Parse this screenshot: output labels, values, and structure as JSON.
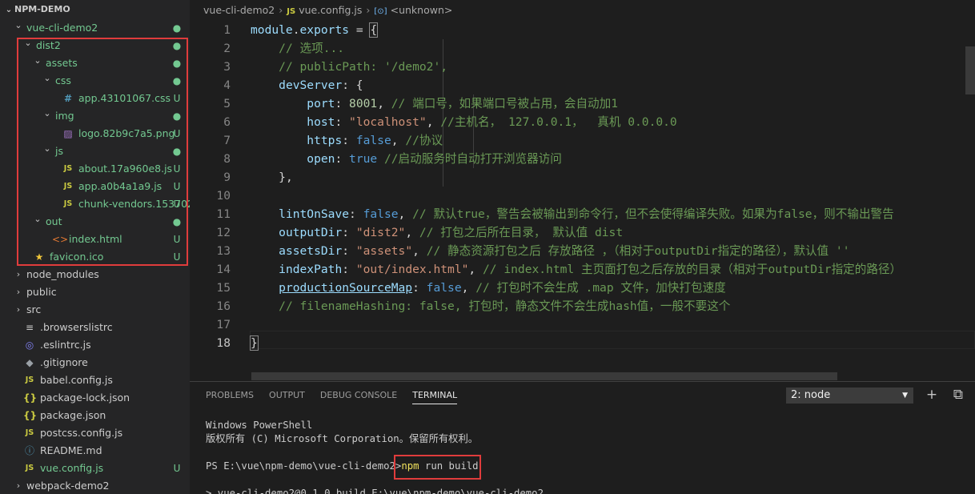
{
  "sidebar": {
    "section_title": "NPM-DEMO",
    "items": [
      {
        "label": "vue-cli-demo2",
        "kind": "folder",
        "open": true,
        "status": "dot"
      },
      {
        "label": "dist2",
        "kind": "folder",
        "open": true,
        "status": "dot"
      },
      {
        "label": "assets",
        "kind": "folder",
        "open": true,
        "status": "dot"
      },
      {
        "label": "css",
        "kind": "folder",
        "open": true,
        "status": "dot"
      },
      {
        "label": "app.43101067.css",
        "kind": "css",
        "status": "U"
      },
      {
        "label": "img",
        "kind": "folder",
        "open": true,
        "status": "dot"
      },
      {
        "label": "logo.82b9c7a5.png",
        "kind": "img",
        "status": "U"
      },
      {
        "label": "js",
        "kind": "folder",
        "open": true,
        "status": "dot"
      },
      {
        "label": "about.17a960e8.js",
        "kind": "js",
        "status": "U"
      },
      {
        "label": "app.a0b4a1a9.js",
        "kind": "js",
        "status": "U"
      },
      {
        "label": "chunk-vendors.153702...",
        "kind": "js",
        "status": "U"
      },
      {
        "label": "out",
        "kind": "folder",
        "open": true,
        "status": "dot"
      },
      {
        "label": "index.html",
        "kind": "html",
        "status": "U"
      },
      {
        "label": "favicon.ico",
        "kind": "star",
        "status": "U"
      },
      {
        "label": "node_modules",
        "kind": "folder",
        "open": false,
        "status": ""
      },
      {
        "label": "public",
        "kind": "folder",
        "open": false,
        "status": ""
      },
      {
        "label": "src",
        "kind": "folder",
        "open": false,
        "status": ""
      },
      {
        "label": ".browserslistrc",
        "kind": "list",
        "status": ""
      },
      {
        "label": ".eslintrc.js",
        "kind": "eslint",
        "status": ""
      },
      {
        "label": ".gitignore",
        "kind": "git",
        "status": ""
      },
      {
        "label": "babel.config.js",
        "kind": "js",
        "status": ""
      },
      {
        "label": "package-lock.json",
        "kind": "json",
        "status": ""
      },
      {
        "label": "package.json",
        "kind": "json",
        "status": ""
      },
      {
        "label": "postcss.config.js",
        "kind": "js",
        "status": ""
      },
      {
        "label": "README.md",
        "kind": "info",
        "status": ""
      },
      {
        "label": "vue.config.js",
        "kind": "js",
        "status": "U"
      },
      {
        "label": "webpack-demo2",
        "kind": "folder",
        "open": false,
        "status": ""
      }
    ]
  },
  "breadcrumb": {
    "folder": "vue-cli-demo2",
    "file_badge": "JS",
    "file": "vue.config.js",
    "symbol_badge": "[⊙]",
    "symbol": "<unknown>"
  },
  "editor": {
    "active_line": "18",
    "lines": [
      {
        "n": "1",
        "t1": "module",
        "t2": ".",
        "t3": "exports",
        "t4": " = ",
        "t5": "{"
      },
      {
        "n": "2",
        "c": "// 选项..."
      },
      {
        "n": "3",
        "c": "// publicPath: '/demo2',"
      },
      {
        "n": "4",
        "k": "devServer",
        "p": ": {"
      },
      {
        "n": "5",
        "k": "port",
        "p": ": ",
        "v": "8001",
        "p2": ", ",
        "c": "// 端口号，如果端口号被占用，会自动加1"
      },
      {
        "n": "6",
        "k": "host",
        "p": ": ",
        "s": "\"localhost\"",
        "p2": ", ",
        "c": "//主机名， 127.0.0.1，  真机 0.0.0.0"
      },
      {
        "n": "7",
        "k": "https",
        "p": ": ",
        "b": "false",
        "p2": ", ",
        "c": "//协议"
      },
      {
        "n": "8",
        "k": "open",
        "p": ": ",
        "b": "true",
        "p2": " ",
        "c": "//启动服务时自动打开浏览器访问"
      },
      {
        "n": "9",
        "p": "},"
      },
      {
        "n": "10"
      },
      {
        "n": "11",
        "k": "lintOnSave",
        "p": ": ",
        "b": "false",
        "p2": ", ",
        "c": "// 默认true，警告会被输出到命令行，但不会使得编译失败。如果为false，则不输出警告"
      },
      {
        "n": "12",
        "k": "outputDir",
        "p": ": ",
        "s": "\"dist2\"",
        "p2": ", ",
        "c": "// 打包之后所在目录， 默认值 dist"
      },
      {
        "n": "13",
        "k": "assetsDir",
        "p": ": ",
        "s": "\"assets\"",
        "p2": ", ",
        "c": "// 静态资源打包之后 存放路径 ，（相对于outputDir指定的路径），默认值 ''"
      },
      {
        "n": "14",
        "k": "indexPath",
        "p": ": ",
        "s": "\"out/index.html\"",
        "p2": ", ",
        "c": "// index.html 主页面打包之后存放的目录（相对于outputDir指定的路径）"
      },
      {
        "n": "15",
        "k": "productionSourceMap",
        "p": ": ",
        "b": "false",
        "p2": ", ",
        "c": "// 打包时不会生成 .map 文件，加快打包速度"
      },
      {
        "n": "16",
        "c": "// filenameHashing: false, 打包时，静态文件不会生成hash值，一般不要这个"
      },
      {
        "n": "17"
      },
      {
        "n": "18",
        "p": "}"
      }
    ]
  },
  "panel": {
    "tabs": [
      "PROBLEMS",
      "OUTPUT",
      "DEBUG CONSOLE",
      "TERMINAL"
    ],
    "active_tab": "TERMINAL",
    "terminal_select": "2: node",
    "add_icon": "+",
    "split_icon": "⧉",
    "terminal": {
      "line1": "Windows PowerShell",
      "line2": "版权所有 (C) Microsoft Corporation。保留所有权利。",
      "prompt": "PS E:\\vue\\npm-demo\\vue-cli-demo2>",
      "cmd_npm": "npm",
      "cmd_rest": " run build",
      "line4": "> vue-cli-demo2@0.1.0 build E:\\vue\\npm-demo\\vue-cli-demo2"
    }
  },
  "colors": {
    "highlight_box": "#e03c3c",
    "untracked": "#73c991"
  }
}
